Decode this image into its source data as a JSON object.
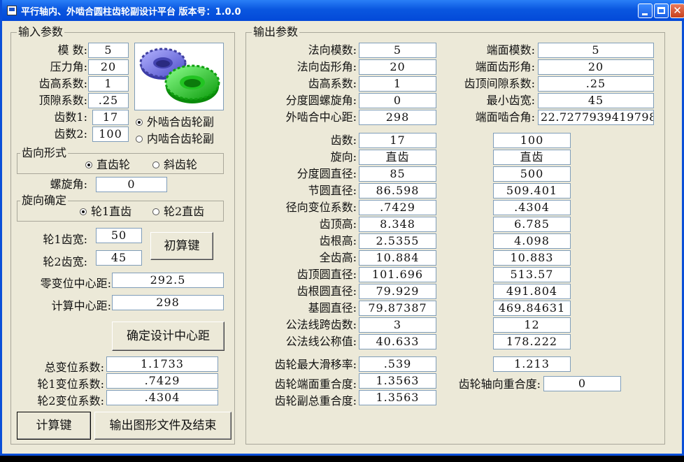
{
  "window": {
    "title": "平行轴内、外啮合圆柱齿轮副设计平台  版本号：1.0.0"
  },
  "input": {
    "legend": "输入参数",
    "module_label": "模    数:",
    "module": "5",
    "pressure_angle_label": "压力角:",
    "pressure_angle": "20",
    "addendum_coef_label": "齿高系数:",
    "addendum_coef": "1",
    "clearance_coef_label": "顶隙系数:",
    "clearance_coef": ".25",
    "teeth1_label": "齿数1:",
    "teeth1": "17",
    "teeth2_label": "齿数2:",
    "teeth2": "100",
    "mesh_external": "外啮合齿轮副",
    "mesh_internal": "内啮合齿轮副",
    "tooth_form_legend": "齿向形式",
    "spur": "直齿轮",
    "helical": "斜齿轮",
    "helix_angle_label": "螺旋角:",
    "helix_angle": "0",
    "hand_legend": "旋向确定",
    "hand1": "轮1直齿",
    "hand2": "轮2直齿",
    "width1_label": "轮1齿宽:",
    "width1": "50",
    "width2_label": "轮2齿宽:",
    "width2": "45",
    "prelim_button": "初算键",
    "zero_center_label": "零变位中心距:",
    "zero_center": "292.5",
    "calc_center_label": "计算中心距:",
    "calc_center": "298",
    "confirm_center_button": "确定设计中心距",
    "total_shift_label": "总变位系数:",
    "total_shift": "1.1733",
    "shift1_label": "轮1变位系数:",
    "shift1": ".7429",
    "shift2_label": "轮2变位系数:",
    "shift2": ".4304",
    "compute_button": "计算键",
    "export_button": "输出图形文件及结束"
  },
  "output": {
    "legend": "输出参数",
    "normal_module_label": "法向模数:",
    "normal_module": "5",
    "normal_pressure_label": "法向齿形角:",
    "normal_pressure": "20",
    "addendum_coef_label": "齿高系数:",
    "addendum_coef": "1",
    "helix_label": "分度圆螺旋角:",
    "helix": "0",
    "center_label": "外啮合中心距:",
    "center": "298",
    "transverse_module_label": "端面模数:",
    "transverse_module": "5",
    "transverse_pressure_label": "端面齿形角:",
    "transverse_pressure": "20",
    "tip_clearance_label": "齿顶间隙系数:",
    "tip_clearance": ".25",
    "min_width_label": "最小齿宽:",
    "min_width": "45",
    "working_angle_label": "端面啮合角:",
    "working_angle": "22.7277939419798",
    "rows": [
      {
        "label": "齿数:",
        "g1": "17",
        "g2": "100"
      },
      {
        "label": "旋向:",
        "g1": "直齿",
        "g2": "直齿"
      },
      {
        "label": "分度圆直径:",
        "g1": "85",
        "g2": "500"
      },
      {
        "label": "节圆直径:",
        "g1": "86.598",
        "g2": "509.401"
      },
      {
        "label": "径向变位系数:",
        "g1": ".7429",
        "g2": ".4304"
      },
      {
        "label": "齿顶高:",
        "g1": "8.348",
        "g2": "6.785"
      },
      {
        "label": "齿根高:",
        "g1": "2.5355",
        "g2": "4.098"
      },
      {
        "label": "全齿高:",
        "g1": "10.884",
        "g2": "10.883"
      },
      {
        "label": "齿顶圆直径:",
        "g1": "101.696",
        "g2": "513.57"
      },
      {
        "label": "齿根圆直径:",
        "g1": "79.929",
        "g2": "491.804"
      },
      {
        "label": "基圆直径:",
        "g1": "79.87387",
        "g2": "469.84631"
      },
      {
        "label": "公法线跨齿数:",
        "g1": "3",
        "g2": "12"
      },
      {
        "label": "公法线公称值:",
        "g1": "40.633",
        "g2": "178.222"
      }
    ],
    "slide_label": "齿轮最大滑移率:",
    "slide1": ".539",
    "slide2": "1.213",
    "transverse_contact_label": "齿轮端面重合度:",
    "transverse_contact": "1.3563",
    "axial_contact_label": "齿轮轴向重合度:",
    "axial_contact": "0",
    "total_contact_label": "齿轮副总重合度:",
    "total_contact": "1.3563"
  }
}
